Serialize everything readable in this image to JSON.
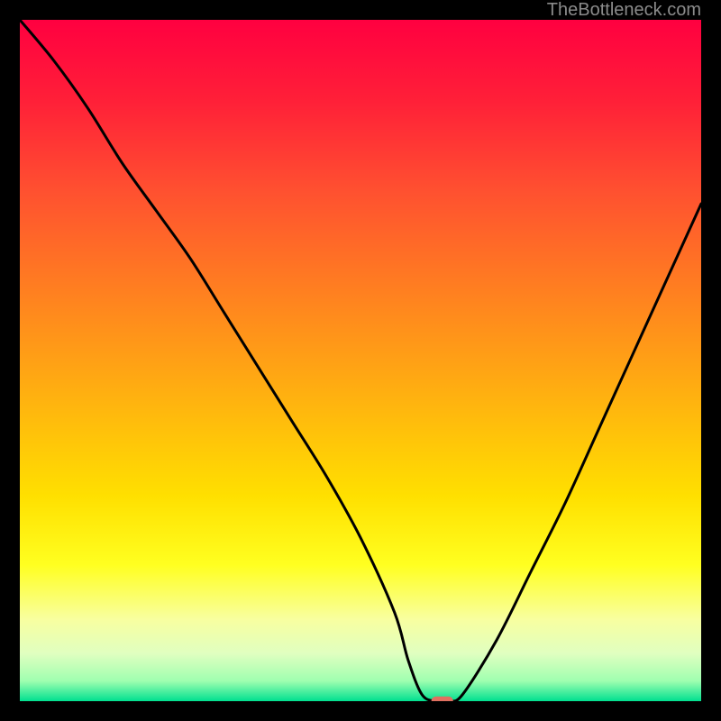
{
  "watermark": "TheBottleneck.com",
  "chart_data": {
    "type": "line",
    "title": "",
    "xlabel": "",
    "ylabel": "",
    "xlim": [
      0,
      100
    ],
    "ylim": [
      0,
      100
    ],
    "x": [
      0,
      5,
      10,
      15,
      20,
      25,
      30,
      35,
      40,
      45,
      50,
      55,
      57,
      59,
      61,
      63,
      65,
      70,
      75,
      80,
      85,
      90,
      95,
      100
    ],
    "values": [
      100,
      94,
      87,
      79,
      72,
      65,
      57,
      49,
      41,
      33,
      24,
      13,
      6,
      1,
      0,
      0,
      1,
      9,
      19,
      29,
      40,
      51,
      62,
      73
    ],
    "marker": {
      "x": 62,
      "y": 0,
      "width": 3.2,
      "height": 1.4,
      "color": "#e07060"
    },
    "gradient_stops": [
      {
        "offset": 0.0,
        "color": "#ff0040"
      },
      {
        "offset": 0.12,
        "color": "#ff2038"
      },
      {
        "offset": 0.25,
        "color": "#ff5030"
      },
      {
        "offset": 0.4,
        "color": "#ff8020"
      },
      {
        "offset": 0.55,
        "color": "#ffb010"
      },
      {
        "offset": 0.7,
        "color": "#ffe000"
      },
      {
        "offset": 0.8,
        "color": "#ffff20"
      },
      {
        "offset": 0.88,
        "color": "#f8ffa0"
      },
      {
        "offset": 0.93,
        "color": "#e0ffc0"
      },
      {
        "offset": 0.97,
        "color": "#a0ffb0"
      },
      {
        "offset": 1.0,
        "color": "#00e090"
      }
    ]
  }
}
